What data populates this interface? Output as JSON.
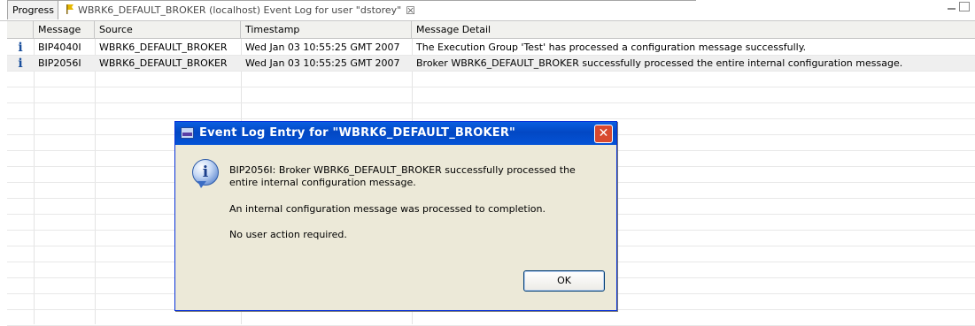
{
  "tabs": {
    "progress_label": "Progress",
    "event_log_label": "WBRK6_DEFAULT_BROKER (localhost)  Event Log for user \"dstorey\""
  },
  "columns": [
    "Message",
    "Source",
    "Timestamp",
    "Message Detail"
  ],
  "rows": [
    {
      "message": "BIP4040I",
      "source": "WBRK6_DEFAULT_BROKER",
      "timestamp": "Wed Jan 03 10:55:25 GMT 2007",
      "detail": "The Execution Group 'Test' has processed a configuration message successfully."
    },
    {
      "message": "BIP2056I",
      "source": "WBRK6_DEFAULT_BROKER",
      "timestamp": "Wed Jan 03 10:55:25 GMT 2007",
      "detail": "Broker WBRK6_DEFAULT_BROKER successfully processed the entire internal configuration message."
    }
  ],
  "dialog": {
    "title": "Event Log Entry for \"WBRK6_DEFAULT_BROKER\"",
    "line1": "BIP2056I: Broker WBRK6_DEFAULT_BROKER successfully processed the",
    "line2": "entire internal configuration message.",
    "line3": "An internal configuration message was processed to completion.",
    "line4": "No user action required.",
    "ok_label": "OK"
  },
  "icons": {
    "info_glyph": "i",
    "close_glyph": "✕",
    "tab_close_glyph": "☒"
  },
  "colors": {
    "titlebar": "#0453d6",
    "info_blue": "#1a4f9c"
  }
}
